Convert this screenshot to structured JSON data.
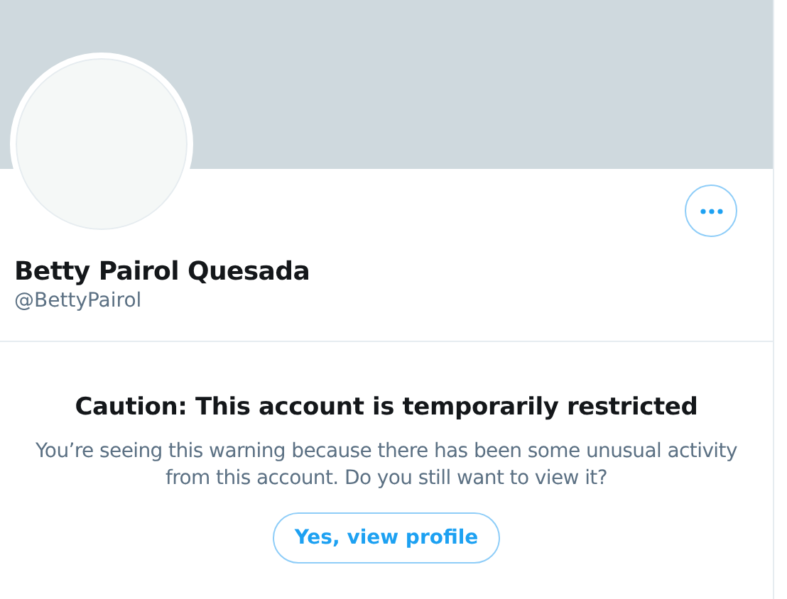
{
  "profile": {
    "name": "Betty Pairol Quesada",
    "handle": "@BettyPairol"
  },
  "warning": {
    "title": "Caution: This account is temporarily restricted",
    "message": "You’re seeing this warning because there has been some unusual activity from this account. Do you still want to view it?",
    "button": "Yes, view profile"
  }
}
